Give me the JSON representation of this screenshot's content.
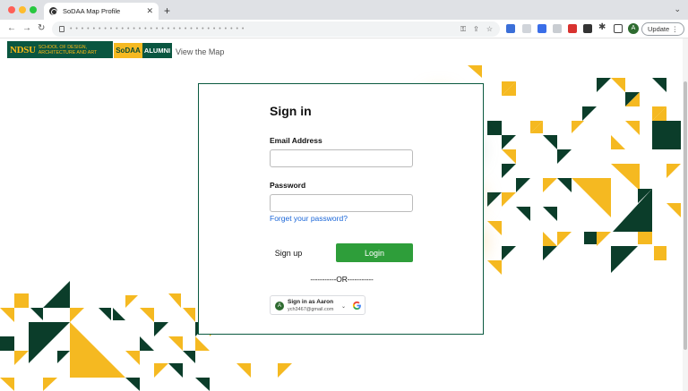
{
  "browser": {
    "tab_title": "SoDAA Map Profile",
    "tab_close": "✕",
    "new_tab": "+",
    "tab_menu": "⌄",
    "address_masked": "• • • • • • • • • • • • • • • • • • • • • • • • • • • • • • •",
    "update_label": "Update",
    "profile_initial": "A"
  },
  "header": {
    "ndsu_wordmark": "NDSU",
    "ndsu_sub_line1": "SCHOOL OF DESIGN,",
    "ndsu_sub_line2": "ARCHITECTURE AND ART",
    "sodaa_label": "SoDAA",
    "alumni_label": "ALUMNI",
    "view_map": "View the Map"
  },
  "login": {
    "title": "Sign in",
    "email_label": "Email Address",
    "email_value": "",
    "password_label": "Password",
    "password_value": "",
    "forget_link": "Forget your password?",
    "signup_label": "Sign up",
    "login_label": "Login",
    "or_separator": "-----------OR-----------"
  },
  "google_signin": {
    "avatar_initial": "A",
    "name_line": "Sign in as Aaron",
    "email_line": "ych3467@gmail.com",
    "chevron": "⌄"
  },
  "colors": {
    "ndsu_green": "#0a5640",
    "ndsu_gold": "#fdb913",
    "login_green": "#2e9e3a",
    "link_blue": "#1a66d8"
  }
}
